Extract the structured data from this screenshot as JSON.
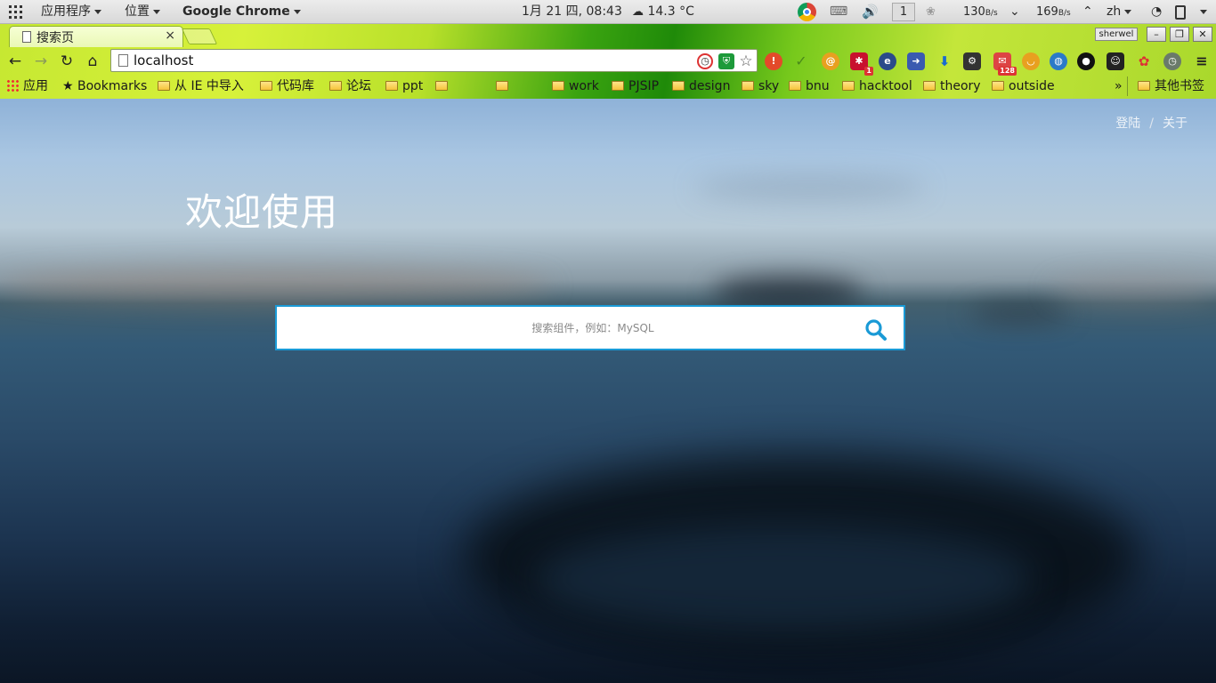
{
  "system_bar": {
    "applications_menu": "应用程序",
    "places_menu": "位置",
    "active_app": "Google Chrome",
    "datetime": "1月 21 四, 08:43",
    "weather": "14.3 °C",
    "workspace": "1",
    "net_down": "130",
    "net_down_unit": "B/s",
    "net_up": "169",
    "net_up_unit": "B/s",
    "input_method": "zh"
  },
  "browser": {
    "tab_title": "搜索页",
    "tab_close": "×",
    "profile_name": "sherwel",
    "address": "localhost",
    "extension_badges": {
      "ext1": "1",
      "mail": "128"
    }
  },
  "bookmarks": {
    "apps_label": "应用",
    "bookmarks_label": "Bookmarks",
    "folders": [
      "从 IE 中导入",
      "代码库",
      "论坛",
      "ppt",
      "",
      "",
      "work",
      "PJSIP",
      "design",
      "sky",
      "bnu",
      "hacktool",
      "theory",
      "outside"
    ],
    "overflow": "»",
    "other_label": "其他书签"
  },
  "page": {
    "nav": {
      "login": "登陆",
      "separator": "/",
      "about": "关于"
    },
    "welcome": "欢迎使用",
    "search": {
      "placeholder": "搜索组件，例如：MySQL",
      "value": ""
    }
  },
  "colors": {
    "search_border": "#1a9ad6",
    "search_icon": "#1a9ad6",
    "chrome_theme": "#3aa310"
  }
}
